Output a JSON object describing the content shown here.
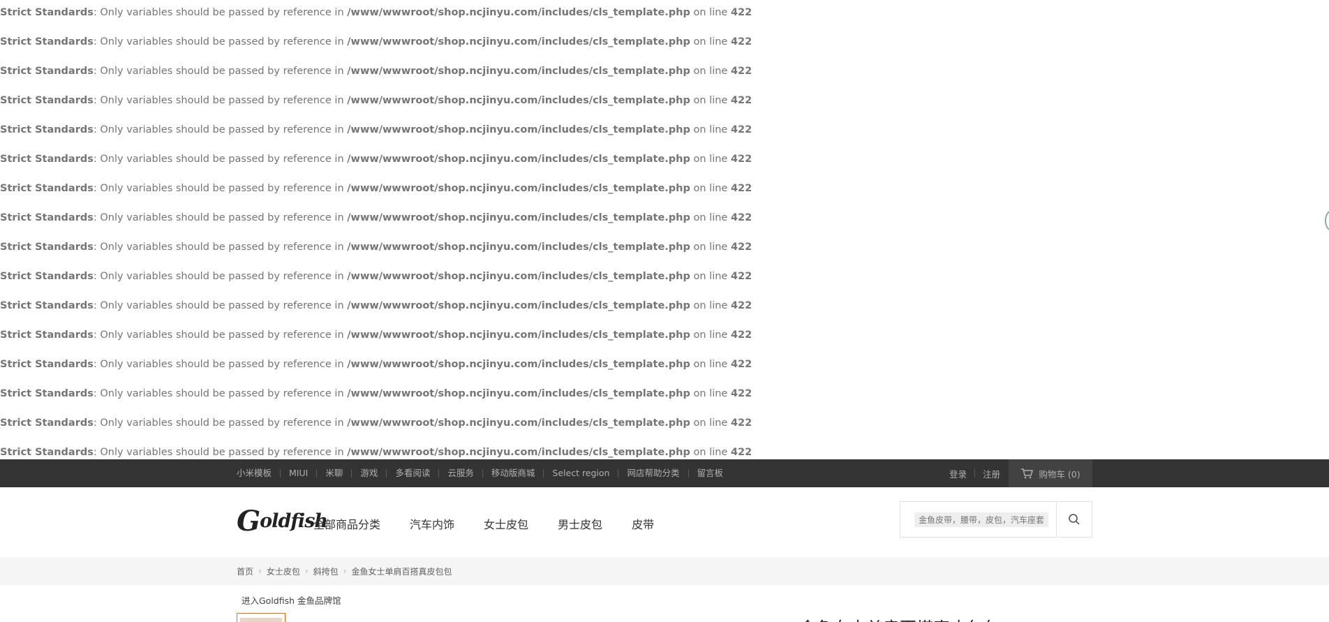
{
  "warnings": [
    {
      "label": "Strict Standards",
      "message": ": Only variables should be passed by reference in ",
      "file": "/www/wwwroot/shop.ncjinyu.com/includes/cls_template.php",
      "on_line": " on line ",
      "line": "422"
    },
    {
      "label": "Strict Standards",
      "message": ": Only variables should be passed by reference in ",
      "file": "/www/wwwroot/shop.ncjinyu.com/includes/cls_template.php",
      "on_line": " on line ",
      "line": "422"
    },
    {
      "label": "Strict Standards",
      "message": ": Only variables should be passed by reference in ",
      "file": "/www/wwwroot/shop.ncjinyu.com/includes/cls_template.php",
      "on_line": " on line ",
      "line": "422"
    },
    {
      "label": "Strict Standards",
      "message": ": Only variables should be passed by reference in ",
      "file": "/www/wwwroot/shop.ncjinyu.com/includes/cls_template.php",
      "on_line": " on line ",
      "line": "422"
    },
    {
      "label": "Strict Standards",
      "message": ": Only variables should be passed by reference in ",
      "file": "/www/wwwroot/shop.ncjinyu.com/includes/cls_template.php",
      "on_line": " on line ",
      "line": "422"
    },
    {
      "label": "Strict Standards",
      "message": ": Only variables should be passed by reference in ",
      "file": "/www/wwwroot/shop.ncjinyu.com/includes/cls_template.php",
      "on_line": " on line ",
      "line": "422"
    },
    {
      "label": "Strict Standards",
      "message": ": Only variables should be passed by reference in ",
      "file": "/www/wwwroot/shop.ncjinyu.com/includes/cls_template.php",
      "on_line": " on line ",
      "line": "422"
    },
    {
      "label": "Strict Standards",
      "message": ": Only variables should be passed by reference in ",
      "file": "/www/wwwroot/shop.ncjinyu.com/includes/cls_template.php",
      "on_line": " on line ",
      "line": "422"
    },
    {
      "label": "Strict Standards",
      "message": ": Only variables should be passed by reference in ",
      "file": "/www/wwwroot/shop.ncjinyu.com/includes/cls_template.php",
      "on_line": " on line ",
      "line": "422"
    },
    {
      "label": "Strict Standards",
      "message": ": Only variables should be passed by reference in ",
      "file": "/www/wwwroot/shop.ncjinyu.com/includes/cls_template.php",
      "on_line": " on line ",
      "line": "422"
    },
    {
      "label": "Strict Standards",
      "message": ": Only variables should be passed by reference in ",
      "file": "/www/wwwroot/shop.ncjinyu.com/includes/cls_template.php",
      "on_line": " on line ",
      "line": "422"
    },
    {
      "label": "Strict Standards",
      "message": ": Only variables should be passed by reference in ",
      "file": "/www/wwwroot/shop.ncjinyu.com/includes/cls_template.php",
      "on_line": " on line ",
      "line": "422"
    },
    {
      "label": "Strict Standards",
      "message": ": Only variables should be passed by reference in ",
      "file": "/www/wwwroot/shop.ncjinyu.com/includes/cls_template.php",
      "on_line": " on line ",
      "line": "422"
    },
    {
      "label": "Strict Standards",
      "message": ": Only variables should be passed by reference in ",
      "file": "/www/wwwroot/shop.ncjinyu.com/includes/cls_template.php",
      "on_line": " on line ",
      "line": "422"
    },
    {
      "label": "Strict Standards",
      "message": ": Only variables should be passed by reference in ",
      "file": "/www/wwwroot/shop.ncjinyu.com/includes/cls_template.php",
      "on_line": " on line ",
      "line": "422"
    },
    {
      "label": "Strict Standards",
      "message": ": Only variables should be passed by reference in ",
      "file": "/www/wwwroot/shop.ncjinyu.com/includes/cls_template.php",
      "on_line": " on line ",
      "line": "422"
    }
  ],
  "topbar": {
    "links": [
      "小米模板",
      "MIUI",
      "米聊",
      "游戏",
      "多看阅读",
      "云服务",
      "移动版商城",
      "Select region",
      "网店帮助分类",
      "留言板"
    ],
    "login": "登录",
    "register": "注册",
    "cart_label": "购物车 (0)",
    "cart_icon": "cart-icon"
  },
  "header": {
    "logo_text": "oldfish",
    "logo_initial": "G",
    "nav": [
      "全部商品分类",
      "汽车内饰",
      "女士皮包",
      "男士皮包",
      "皮带"
    ],
    "search_hint": "金鱼皮带，腰带，皮包，汽车座套",
    "search_icon": "search-icon"
  },
  "breadcrumb": [
    "首页",
    "女士皮包",
    "斜挎包",
    "金鱼女士单肩百搭真皮包包"
  ],
  "brand_link": "进入Goldfish 金鱼品牌馆",
  "product_title": "金鱼女士单肩百搭真皮包包",
  "colors": {
    "topbar": "#333333",
    "accent": "#ff6700",
    "crumb_bg": "#f5f5f5"
  }
}
